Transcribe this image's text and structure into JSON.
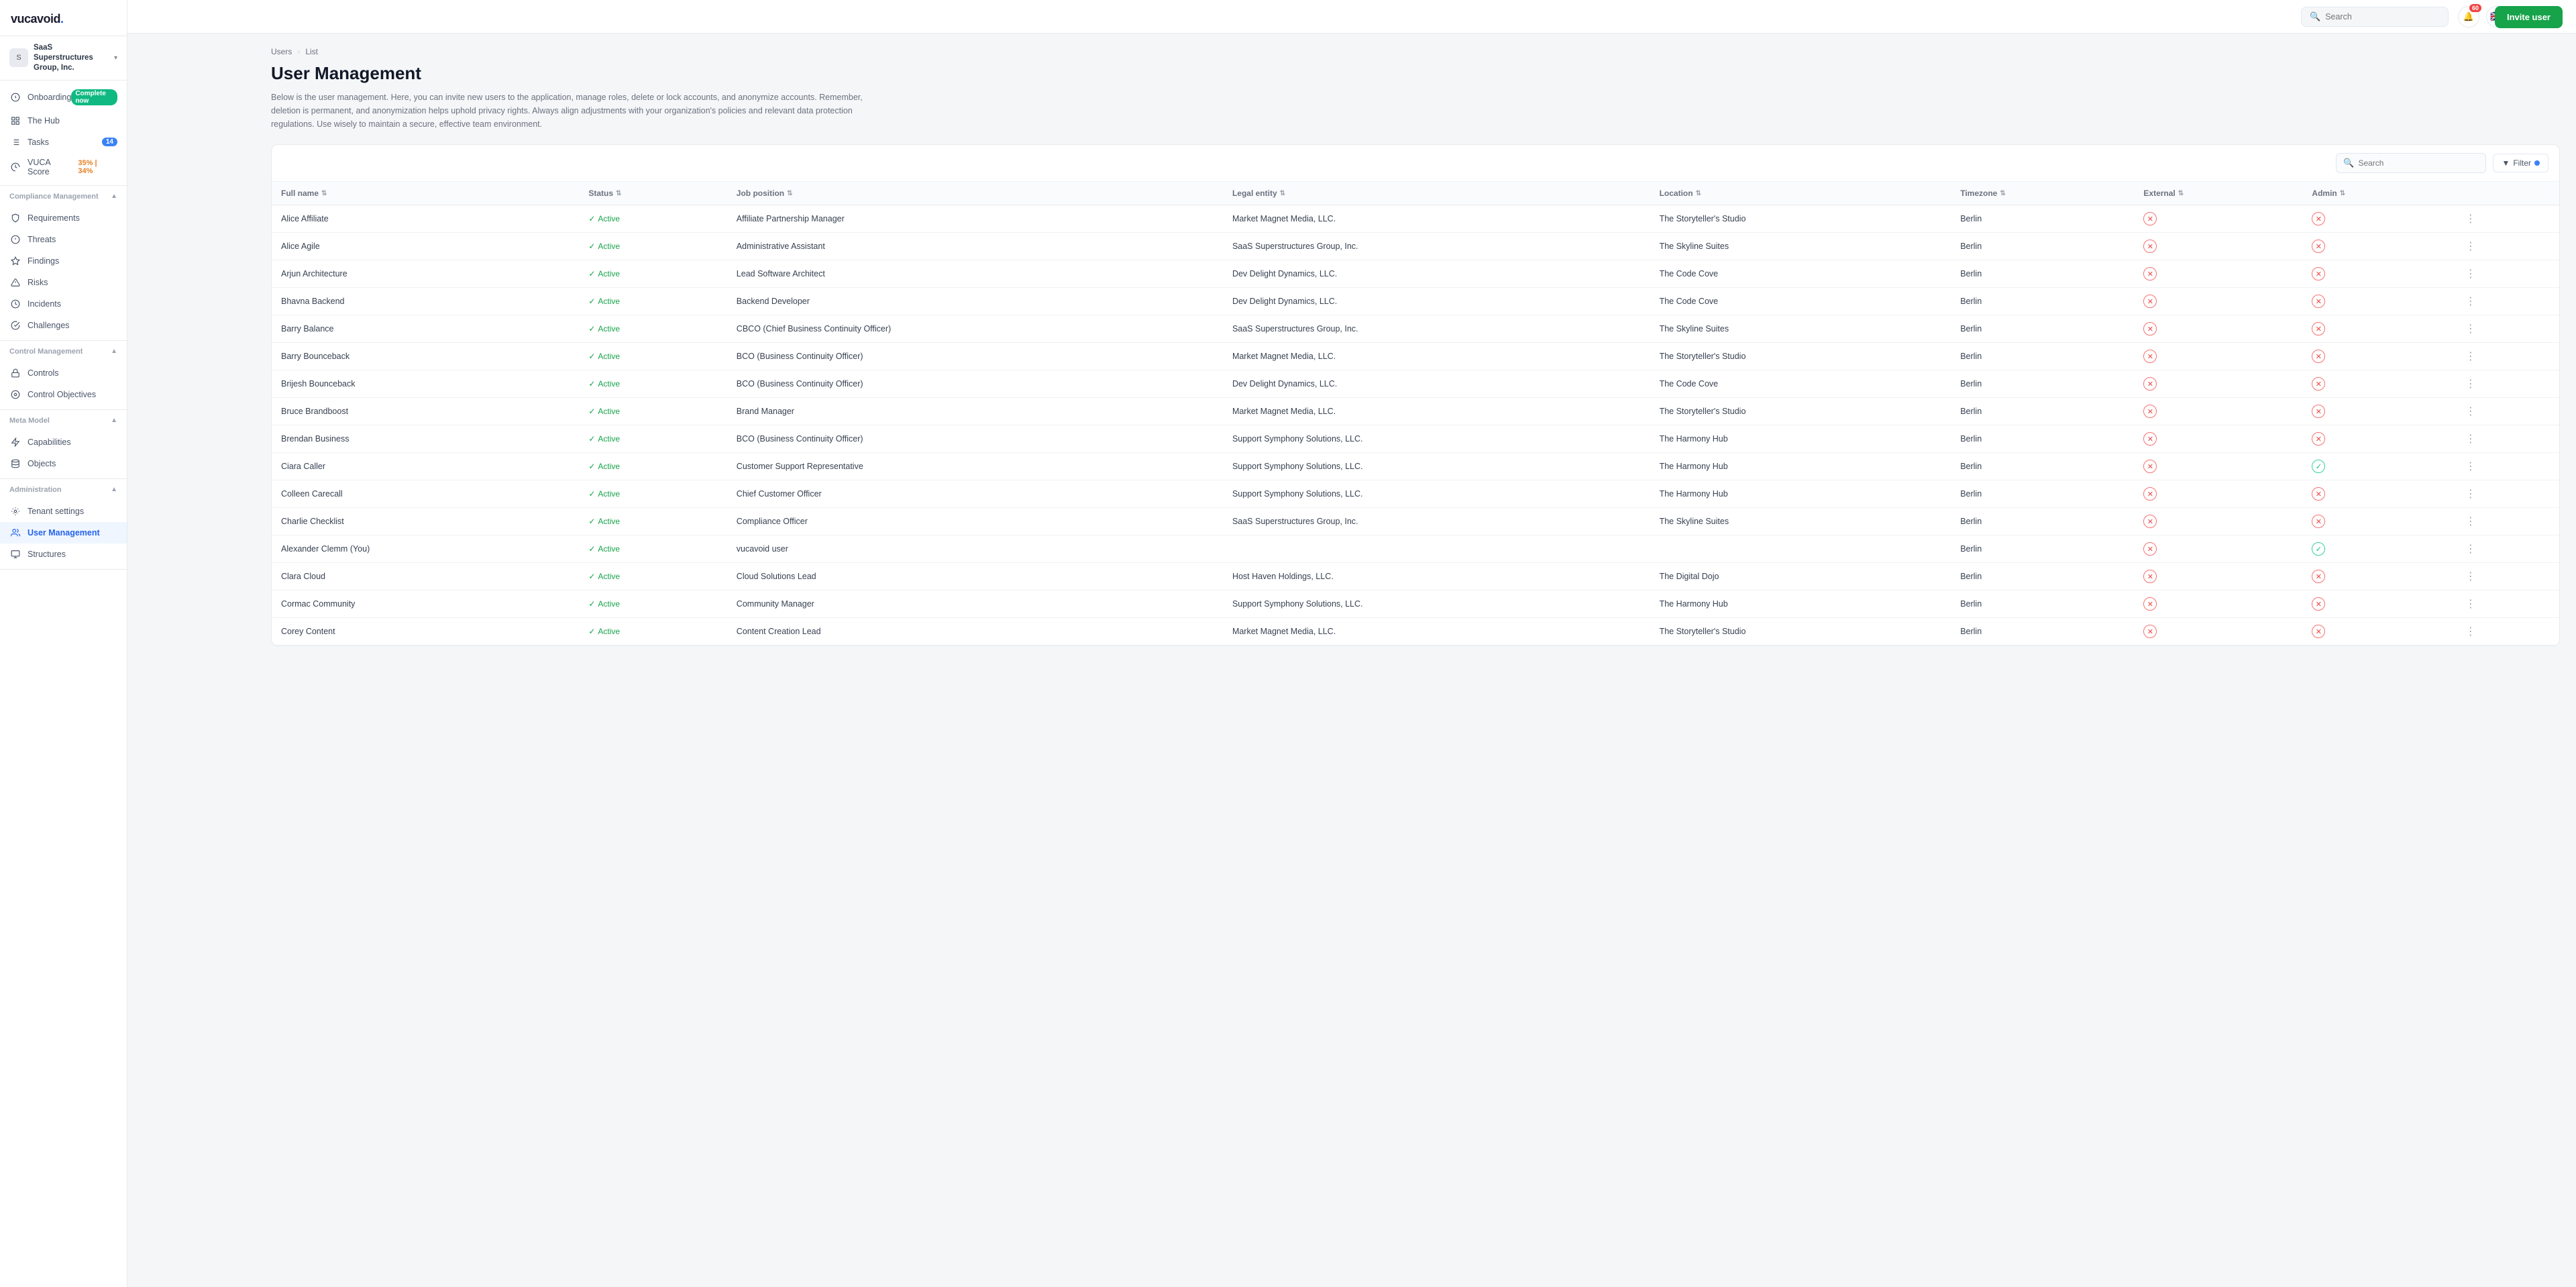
{
  "app": {
    "name": "vucavoid",
    "dot": "."
  },
  "topbar": {
    "search_placeholder": "Search",
    "notification_count": "60",
    "add_label": "+",
    "invite_button": "Invite user"
  },
  "sidebar": {
    "org": {
      "name": "SaaS Superstructures Group, Inc.",
      "icon": "S"
    },
    "nav_items": [
      {
        "id": "onboarding",
        "label": "Onboarding",
        "badge": "Complete now",
        "badge_type": "green"
      },
      {
        "id": "hub",
        "label": "The Hub"
      },
      {
        "id": "tasks",
        "label": "Tasks",
        "badge": "14",
        "badge_type": "blue"
      },
      {
        "id": "vuca-score",
        "label": "VUCA Score",
        "badge": "35% | 34%",
        "badge_type": "score"
      }
    ],
    "sections": [
      {
        "label": "Compliance Management",
        "items": [
          {
            "id": "requirements",
            "label": "Requirements"
          },
          {
            "id": "threats",
            "label": "Threats"
          },
          {
            "id": "findings",
            "label": "Findings"
          },
          {
            "id": "risks",
            "label": "Risks"
          },
          {
            "id": "incidents",
            "label": "Incidents"
          },
          {
            "id": "challenges",
            "label": "Challenges"
          }
        ]
      },
      {
        "label": "Control Management",
        "items": [
          {
            "id": "controls",
            "label": "Controls"
          },
          {
            "id": "control-objectives",
            "label": "Control Objectives"
          }
        ]
      },
      {
        "label": "Meta Model",
        "items": [
          {
            "id": "capabilities",
            "label": "Capabilities"
          },
          {
            "id": "objects",
            "label": "Objects"
          }
        ]
      },
      {
        "label": "Administration",
        "items": [
          {
            "id": "tenant-settings",
            "label": "Tenant settings"
          },
          {
            "id": "user-management",
            "label": "User Management",
            "active": true
          },
          {
            "id": "structures",
            "label": "Structures"
          }
        ]
      }
    ]
  },
  "breadcrumb": {
    "items": [
      "Users",
      "List"
    ]
  },
  "page": {
    "title": "User Management",
    "description": "Below is the user management. Here, you can invite new users to the application, manage roles, delete or lock accounts, and anonymize accounts. Remember, deletion is permanent, and anonymization helps uphold privacy rights. Always align adjustments with your organization's policies and relevant data protection regulations. Use wisely to maintain a secure, effective team environment."
  },
  "table": {
    "search_placeholder": "Search",
    "filter_label": "Filter",
    "columns": [
      {
        "key": "name",
        "label": "Full name"
      },
      {
        "key": "status",
        "label": "Status"
      },
      {
        "key": "job",
        "label": "Job position"
      },
      {
        "key": "legal",
        "label": "Legal entity"
      },
      {
        "key": "location",
        "label": "Location"
      },
      {
        "key": "timezone",
        "label": "Timezone"
      },
      {
        "key": "external",
        "label": "External"
      },
      {
        "key": "admin",
        "label": "Admin"
      }
    ],
    "rows": [
      {
        "name": "Alice Affiliate",
        "status": "Active",
        "job": "Affiliate Partnership Manager",
        "legal": "Market Magnet Media, LLC.",
        "location": "The Storyteller's Studio",
        "timezone": "Berlin",
        "external": false,
        "admin": false
      },
      {
        "name": "Alice Agile",
        "status": "Active",
        "job": "Administrative Assistant",
        "legal": "SaaS Superstructures Group, Inc.",
        "location": "The Skyline Suites",
        "timezone": "Berlin",
        "external": false,
        "admin": false
      },
      {
        "name": "Arjun Architecture",
        "status": "Active",
        "job": "Lead Software Architect",
        "legal": "Dev Delight Dynamics, LLC.",
        "location": "The Code Cove",
        "timezone": "Berlin",
        "external": false,
        "admin": false
      },
      {
        "name": "Bhavna Backend",
        "status": "Active",
        "job": "Backend Developer",
        "legal": "Dev Delight Dynamics, LLC.",
        "location": "The Code Cove",
        "timezone": "Berlin",
        "external": false,
        "admin": false
      },
      {
        "name": "Barry Balance",
        "status": "Active",
        "job": "CBCO (Chief Business Continuity Officer)",
        "legal": "SaaS Superstructures Group, Inc.",
        "location": "The Skyline Suites",
        "timezone": "Berlin",
        "external": false,
        "admin": false
      },
      {
        "name": "Barry Bounceback",
        "status": "Active",
        "job": "BCO (Business Continuity Officer)",
        "legal": "Market Magnet Media, LLC.",
        "location": "The Storyteller's Studio",
        "timezone": "Berlin",
        "external": false,
        "admin": false
      },
      {
        "name": "Brijesh Bounceback",
        "status": "Active",
        "job": "BCO (Business Continuity Officer)",
        "legal": "Dev Delight Dynamics, LLC.",
        "location": "The Code Cove",
        "timezone": "Berlin",
        "external": false,
        "admin": false
      },
      {
        "name": "Bruce Brandboost",
        "status": "Active",
        "job": "Brand Manager",
        "legal": "Market Magnet Media, LLC.",
        "location": "The Storyteller's Studio",
        "timezone": "Berlin",
        "external": false,
        "admin": false
      },
      {
        "name": "Brendan Business",
        "status": "Active",
        "job": "BCO (Business Continuity Officer)",
        "legal": "Support Symphony Solutions, LLC.",
        "location": "The Harmony Hub",
        "timezone": "Berlin",
        "external": false,
        "admin": false
      },
      {
        "name": "Ciara Caller",
        "status": "Active",
        "job": "Customer Support Representative",
        "legal": "Support Symphony Solutions, LLC.",
        "location": "The Harmony Hub",
        "timezone": "Berlin",
        "external": false,
        "admin": true
      },
      {
        "name": "Colleen Carecall",
        "status": "Active",
        "job": "Chief Customer Officer",
        "legal": "Support Symphony Solutions, LLC.",
        "location": "The Harmony Hub",
        "timezone": "Berlin",
        "external": false,
        "admin": false
      },
      {
        "name": "Charlie Checklist",
        "status": "Active",
        "job": "Compliance Officer",
        "legal": "SaaS Superstructures Group, Inc.",
        "location": "The Skyline Suites",
        "timezone": "Berlin",
        "external": false,
        "admin": false
      },
      {
        "name": "Alexander Clemm (You)",
        "status": "Active",
        "job": "vucavoid user",
        "legal": "",
        "location": "",
        "timezone": "Berlin",
        "external": false,
        "admin": true
      },
      {
        "name": "Clara Cloud",
        "status": "Active",
        "job": "Cloud Solutions Lead",
        "legal": "Host Haven Holdings, LLC.",
        "location": "The Digital Dojo",
        "timezone": "Berlin",
        "external": false,
        "admin": false
      },
      {
        "name": "Cormac Community",
        "status": "Active",
        "job": "Community Manager",
        "legal": "Support Symphony Solutions, LLC.",
        "location": "The Harmony Hub",
        "timezone": "Berlin",
        "external": false,
        "admin": false
      },
      {
        "name": "Corey Content",
        "status": "Active",
        "job": "Content Creation Lead",
        "legal": "Market Magnet Media, LLC.",
        "location": "The Storyteller's Studio",
        "timezone": "Berlin",
        "external": false,
        "admin": false
      }
    ]
  }
}
